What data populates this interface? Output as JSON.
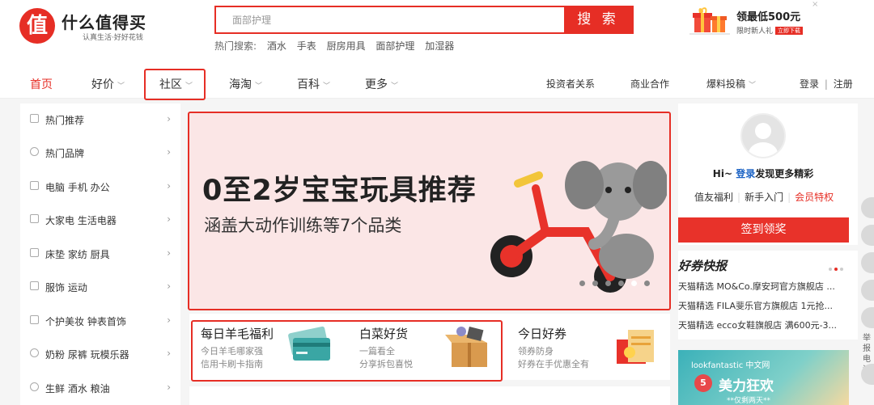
{
  "brand": {
    "mark": "值",
    "name": "什么值得买",
    "slogan": "认真生活·好好花钱"
  },
  "search": {
    "placeholder": "面部护理",
    "button": "搜 索"
  },
  "hot_search": {
    "label": "热门搜索:",
    "items": [
      "酒水",
      "手表",
      "厨房用具",
      "面部护理",
      "加湿器"
    ]
  },
  "promo": {
    "title": "领最低500元",
    "subtitle": "限时新人礼",
    "button": "立即下载"
  },
  "nav": {
    "left": [
      "首页",
      "好价",
      "社区",
      "海淘",
      "百科",
      "更多"
    ],
    "right": [
      "投资者关系",
      "商业合作",
      "爆料投稿"
    ],
    "login": "登录",
    "divider": "|",
    "register": "注册"
  },
  "sidebar": {
    "items": [
      "热门推荐",
      "热门品牌",
      "电脑  手机  办公",
      "大家电  生活电器",
      "床垫  家纺  厨具",
      "服饰  运动",
      "个护美妆  钟表首饰",
      "奶粉  尿裤  玩模乐器",
      "生鲜  酒水  粮油"
    ]
  },
  "banner": {
    "title": "0至2岁宝宝玩具推荐",
    "subtitle": "涵盖大动作训练等7个品类",
    "slides": 6,
    "active_slide": 5
  },
  "cards": [
    {
      "title": "每日羊毛福利",
      "desc1": "今日羊毛哪家强",
      "desc2": "信用卡刷卡指南"
    },
    {
      "title": "白菜好货",
      "desc1": "一篇看全",
      "desc2": "分享拆包喜悦"
    },
    {
      "title": "今日好券",
      "desc1": "领券防身",
      "desc2": "好券在手优惠全有"
    }
  ],
  "user": {
    "greeting": "Hi~",
    "login": "登录",
    "greeting_tail": "发现更多精彩",
    "links": [
      "值友福利",
      "新手入门",
      "会员特权"
    ],
    "signin": "签到领奖"
  },
  "coupon": {
    "title": "好券快报",
    "items": [
      "天猫精选 MO&Co.摩安珂官方旗舰店 ...",
      "天猫精选 FILA斐乐官方旗舰店 1元抢...",
      "天猫精选 ecco女鞋旗舰店 满600元-3..."
    ]
  },
  "ad": {
    "brand": "lookfantastic 中文网",
    "num": "5",
    "title": "美力狂欢",
    "sub": "**仅剩两天**"
  },
  "side_float": {
    "text": "举报电话"
  },
  "colors": {
    "brand_red": "#e62e25",
    "link_blue": "#1a62c4",
    "banner_bg": "#fbe6e6"
  }
}
